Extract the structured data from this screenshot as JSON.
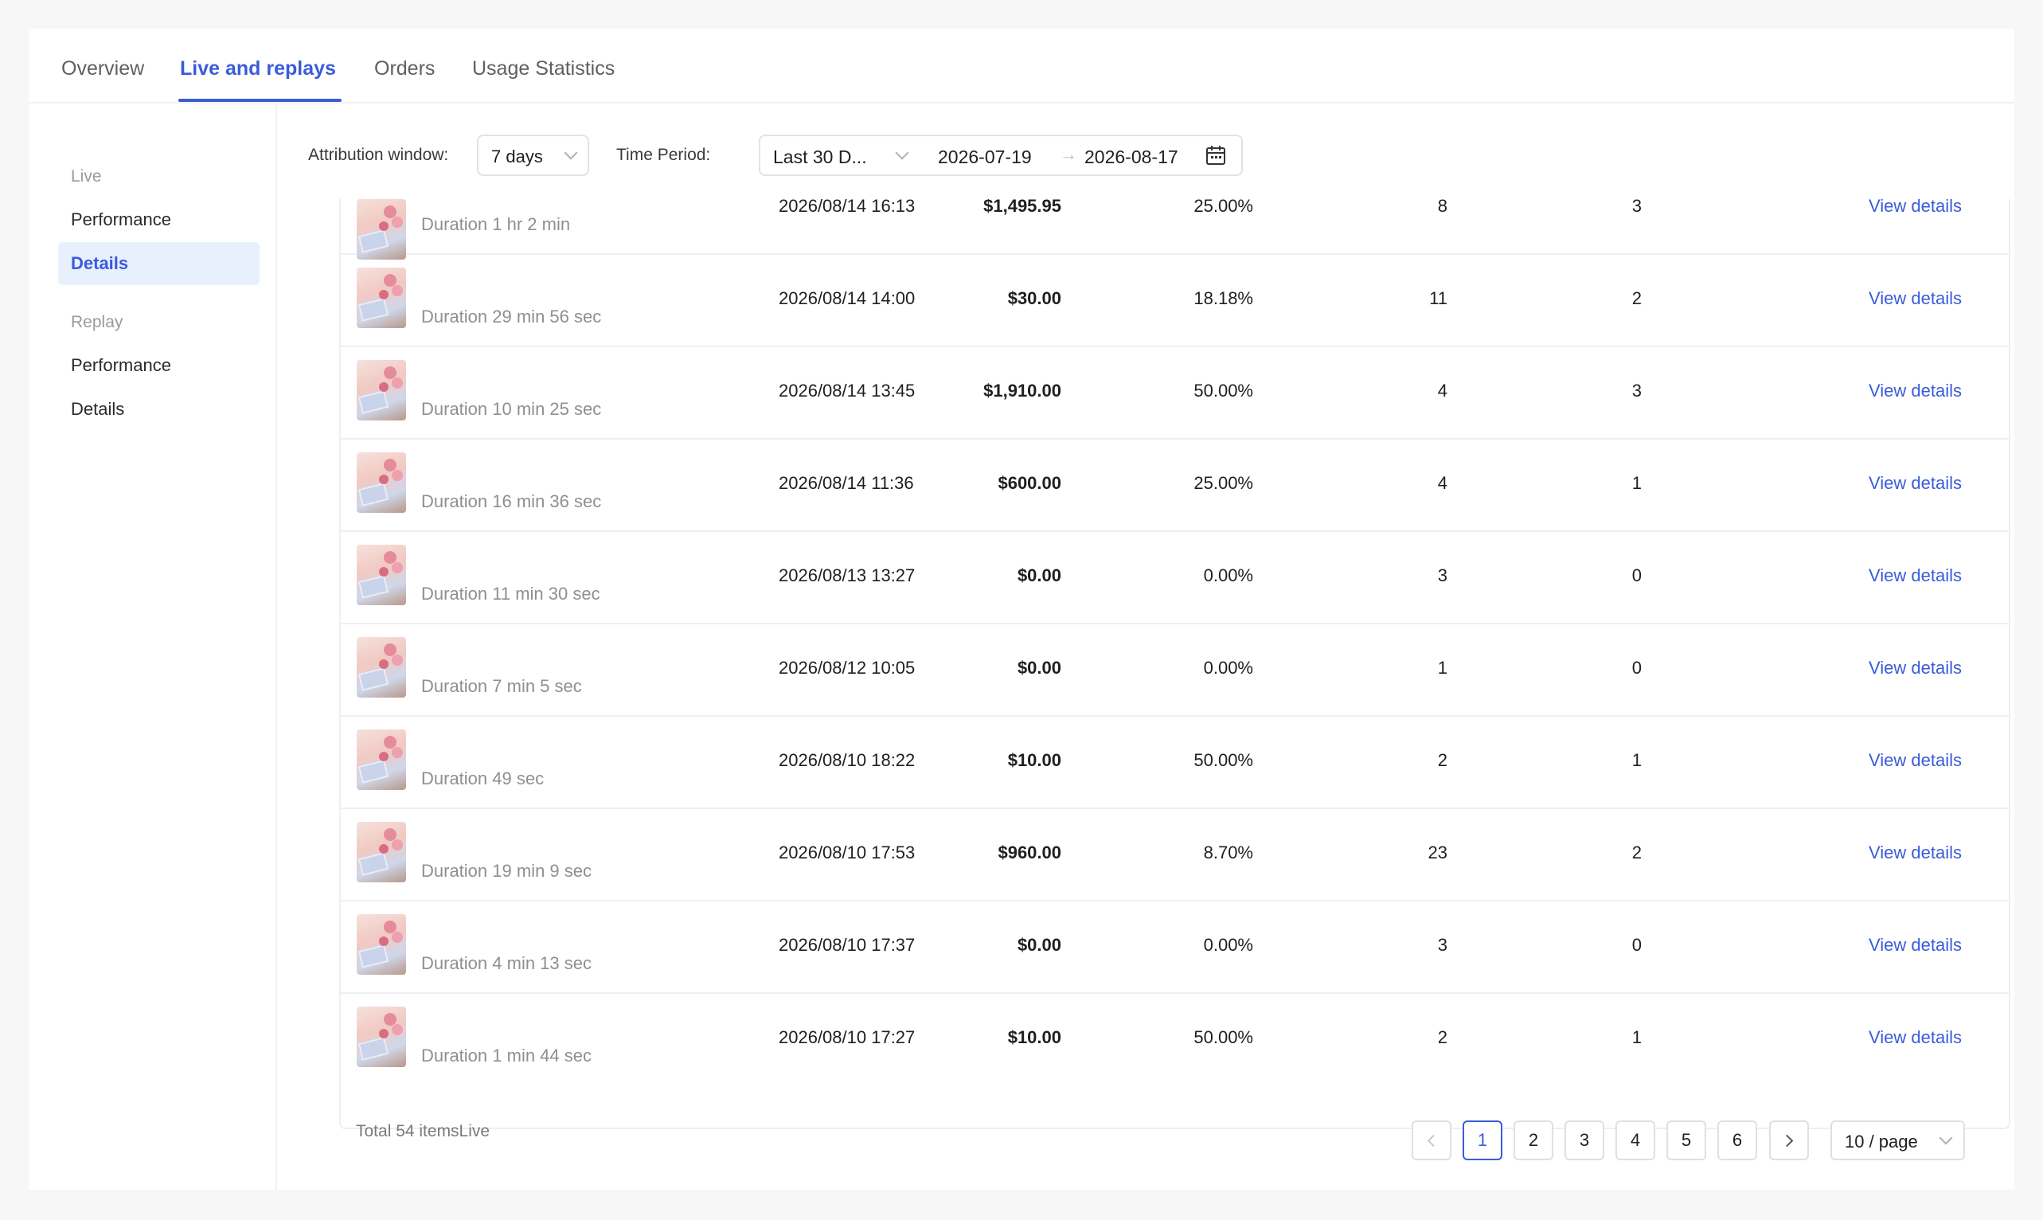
{
  "tabs": [
    {
      "label": "Overview"
    },
    {
      "label": "Live and replays"
    },
    {
      "label": "Orders"
    },
    {
      "label": "Usage Statistics"
    }
  ],
  "sidebar": {
    "live_group": "Live",
    "live_items": [
      {
        "label": "Performance"
      },
      {
        "label": "Details"
      }
    ],
    "replay_group": "Replay",
    "replay_items": [
      {
        "label": "Performance"
      },
      {
        "label": "Details"
      }
    ]
  },
  "filters": {
    "attribution_label": "Attribution window:",
    "attribution_value": "7 days",
    "period_label": "Time Period:",
    "period_value": "Last 30 D...",
    "start_date": "2026-07-19",
    "range_arrow": "→",
    "end_date": "2026-08-17"
  },
  "table": {
    "link_label": "View details",
    "rows": [
      {
        "duration": "Duration 1 hr 2 min",
        "time": "2026/08/14 16:13",
        "revenue": "$1,495.95",
        "rate": "25.00%",
        "count_a": "8",
        "count_b": "3"
      },
      {
        "duration": "Duration 29 min 56 sec",
        "time": "2026/08/14 14:00",
        "revenue": "$30.00",
        "rate": "18.18%",
        "count_a": "11",
        "count_b": "2"
      },
      {
        "duration": "Duration 10 min 25 sec",
        "time": "2026/08/14 13:45",
        "revenue": "$1,910.00",
        "rate": "50.00%",
        "count_a": "4",
        "count_b": "3"
      },
      {
        "duration": "Duration 16 min 36 sec",
        "time": "2026/08/14 11:36",
        "revenue": "$600.00",
        "rate": "25.00%",
        "count_a": "4",
        "count_b": "1"
      },
      {
        "duration": "Duration 11 min 30 sec",
        "time": "2026/08/13 13:27",
        "revenue": "$0.00",
        "rate": "0.00%",
        "count_a": "3",
        "count_b": "0"
      },
      {
        "duration": "Duration 7 min 5 sec",
        "time": "2026/08/12 10:05",
        "revenue": "$0.00",
        "rate": "0.00%",
        "count_a": "1",
        "count_b": "0"
      },
      {
        "duration": "Duration 49 sec",
        "time": "2026/08/10 18:22",
        "revenue": "$10.00",
        "rate": "50.00%",
        "count_a": "2",
        "count_b": "1"
      },
      {
        "duration": "Duration 19 min 9 sec",
        "time": "2026/08/10 17:53",
        "revenue": "$960.00",
        "rate": "8.70%",
        "count_a": "23",
        "count_b": "2"
      },
      {
        "duration": "Duration 4 min 13 sec",
        "time": "2026/08/10 17:37",
        "revenue": "$0.00",
        "rate": "0.00%",
        "count_a": "3",
        "count_b": "0"
      },
      {
        "duration": "Duration 1 min 44 sec",
        "time": "2026/08/10 17:27",
        "revenue": "$10.00",
        "rate": "50.00%",
        "count_a": "2",
        "count_b": "1"
      }
    ]
  },
  "footer": {
    "total": "Total 54 itemsLive",
    "pages": [
      "1",
      "2",
      "3",
      "4",
      "5",
      "6"
    ],
    "current_page": "1",
    "page_size": "10 / page"
  },
  "colors": {
    "accent": "#3b5bdb",
    "active_bg": "#e8effd"
  }
}
